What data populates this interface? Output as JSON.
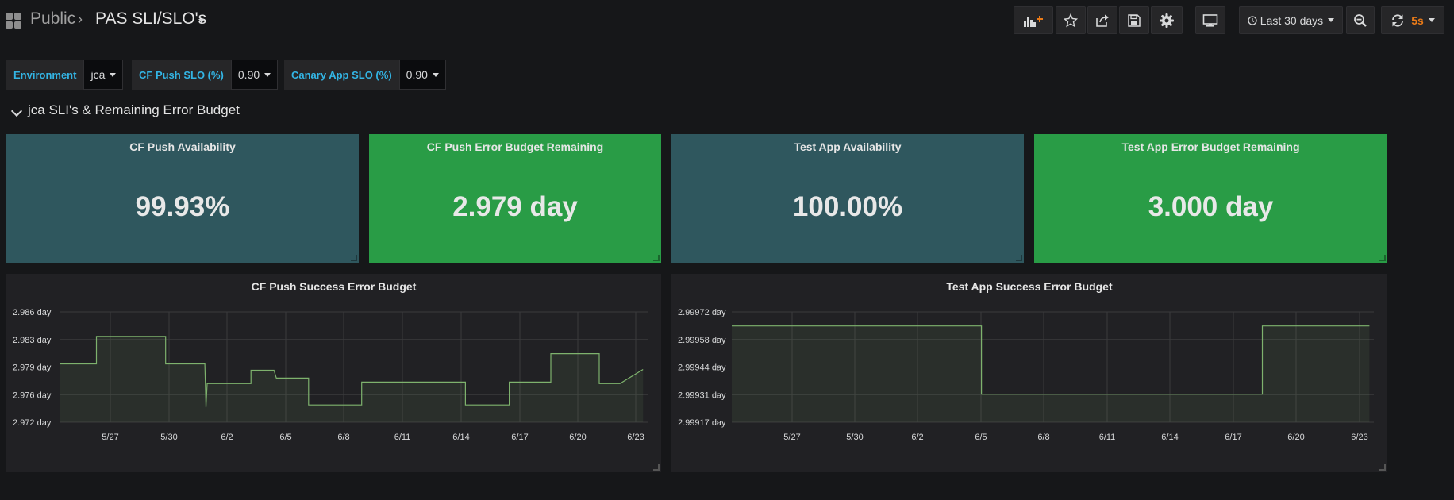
{
  "header": {
    "folder": "Public",
    "separator": "›",
    "dashboard_title": "PAS SLI/SLO's"
  },
  "toolbar": {
    "buttons": [
      "add-panel-icon",
      "star-icon",
      "share-icon",
      "save-icon",
      "gear-icon",
      "tv-mode-icon"
    ],
    "time_range": "Last 30 days",
    "zoom": "zoom-out-icon",
    "refresh_interval": "5s"
  },
  "variables": [
    {
      "label": "Environment",
      "value": "jca"
    },
    {
      "label": "CF Push SLO (%)",
      "value": "0.90"
    },
    {
      "label": "Canary App SLO (%)",
      "value": "0.90"
    }
  ],
  "row": {
    "title": "jca SLI's & Remaining Error Budget"
  },
  "stats": [
    {
      "title": "CF Push Availability",
      "value": "99.93%",
      "color": "#2f575e"
    },
    {
      "title": "CF Push Error Budget Remaining",
      "value": "2.979 day",
      "color": "#299c46"
    },
    {
      "title": "Test App Availability",
      "value": "100.00%",
      "color": "#2f575e"
    },
    {
      "title": "Test App Error Budget Remaining",
      "value": "3.000 day",
      "color": "#299c46"
    }
  ],
  "graphs": [
    {
      "title": "CF Push Success Error Budget"
    },
    {
      "title": "Test App Success Error Budget"
    }
  ],
  "chart_data": [
    {
      "type": "line",
      "title": "CF Push Success Error Budget",
      "y_ticks": [
        "2.986 day",
        "2.983 day",
        "2.979 day",
        "2.976 day",
        "2.972 day"
      ],
      "ylim": [
        2.972,
        2.986
      ],
      "x_ticks": [
        "5/27",
        "5/30",
        "6/2",
        "6/5",
        "6/8",
        "6/11",
        "6/14",
        "6/17",
        "6/20",
        "6/23"
      ],
      "series": [
        {
          "color": "#7eb26d",
          "x": [
            25.0,
            26.6,
            26.6,
            29.6,
            29.6,
            31.3,
            31.35,
            31.4,
            31.5,
            33.3,
            33.3,
            34.3,
            34.4,
            35.8,
            35.8,
            38.1,
            38.1,
            42.6,
            42.6,
            44.5,
            44.5,
            46.3,
            46.3,
            48.4,
            48.4,
            49.3,
            49.3,
            50.3,
            50.3
          ],
          "y": [
            2.9794,
            2.9794,
            2.9829,
            2.9829,
            2.9794,
            2.9794,
            2.9739,
            2.9769,
            2.9769,
            2.9769,
            2.9786,
            2.9786,
            2.9776,
            2.9776,
            2.9742,
            2.9742,
            2.9771,
            2.9771,
            2.9742,
            2.9742,
            2.9771,
            2.9771,
            2.9807,
            2.9807,
            2.9769,
            2.9769,
            2.9769,
            2.9787,
            2.9787
          ]
        }
      ]
    },
    {
      "type": "line",
      "title": "Test App Success Error Budget",
      "y_ticks": [
        "2.99972 day",
        "2.99958 day",
        "2.99944 day",
        "2.99931 day",
        "2.99917 day"
      ],
      "ylim": [
        2.99917,
        2.99972
      ],
      "x_ticks": [
        "5/27",
        "5/30",
        "6/2",
        "6/5",
        "6/8",
        "6/11",
        "6/14",
        "6/17",
        "6/20",
        "6/23"
      ],
      "series": [
        {
          "color": "#7eb26d",
          "x": [
            25.0,
            36.2,
            36.2,
            48.8,
            48.8,
            53.6
          ],
          "y": [
            2.99965,
            2.99965,
            2.99931,
            2.99931,
            2.99965,
            2.99965
          ]
        }
      ]
    }
  ]
}
